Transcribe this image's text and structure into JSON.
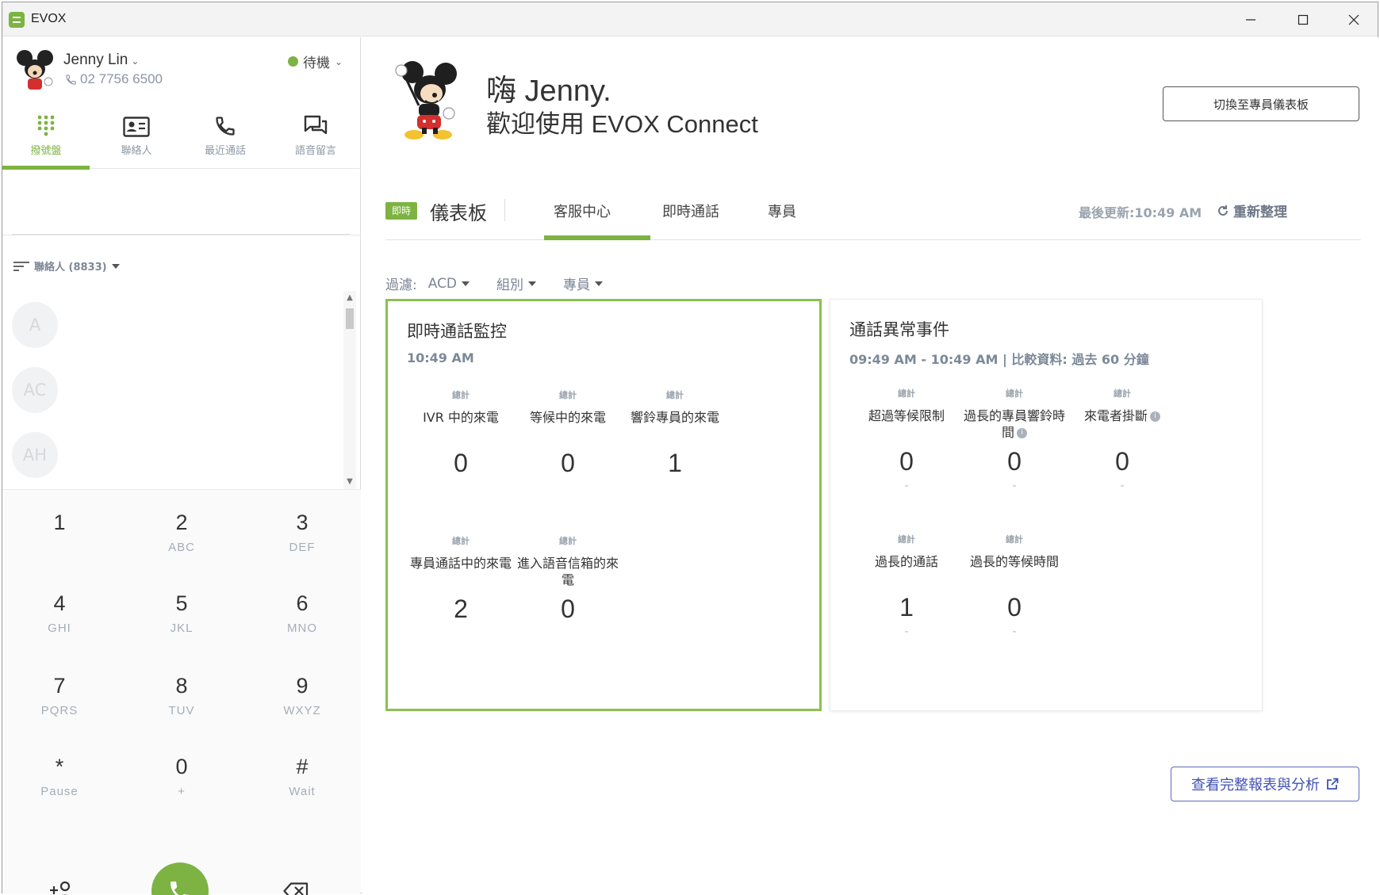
{
  "window": {
    "app_name": "EVOX",
    "minimize_icon": "minimize-icon",
    "maximize_icon": "maximize-icon",
    "close_icon": "close-icon"
  },
  "user": {
    "name": "Jenny Lin",
    "phone": "02 7756 6500",
    "status": "待機",
    "status_color": "#7cb342"
  },
  "nav": {
    "items": [
      {
        "label": "撥號盤",
        "icon": "dialpad-icon",
        "active": true
      },
      {
        "label": "聯絡人",
        "icon": "contact-card-icon",
        "active": false
      },
      {
        "label": "最近通話",
        "icon": "phone-icon",
        "active": false
      },
      {
        "label": "語音留言",
        "icon": "voicemail-chat-icon",
        "active": false
      }
    ]
  },
  "contacts": {
    "header": "聯絡人 (8833)",
    "items": [
      "A",
      "AC",
      "AH"
    ]
  },
  "dialpad": {
    "keys": [
      {
        "digit": "1",
        "sub": ""
      },
      {
        "digit": "2",
        "sub": "ABC"
      },
      {
        "digit": "3",
        "sub": "DEF"
      },
      {
        "digit": "4",
        "sub": "GHI"
      },
      {
        "digit": "5",
        "sub": "JKL"
      },
      {
        "digit": "6",
        "sub": "MNO"
      },
      {
        "digit": "7",
        "sub": "PQRS"
      },
      {
        "digit": "8",
        "sub": "TUV"
      },
      {
        "digit": "9",
        "sub": "WXYZ"
      },
      {
        "digit": "*",
        "sub": "Pause"
      },
      {
        "digit": "0",
        "sub": "+"
      },
      {
        "digit": "#",
        "sub": "Wait"
      }
    ],
    "add_contact_icon": "add-person-icon",
    "call_icon": "phone-call-icon",
    "backspace_icon": "backspace-icon"
  },
  "header": {
    "greeting": "嗨 Jenny.",
    "welcome": "歡迎使用 EVOX Connect",
    "switch_button": "切換至專員儀表板"
  },
  "dashboard": {
    "live_badge": "即時",
    "title": "儀表板",
    "tabs": [
      "客服中心",
      "即時通話",
      "專員"
    ],
    "active_tab": "客服中心",
    "last_updated": "最後更新:10:49 AM",
    "refresh": "重新整理",
    "accent": "#7cb342"
  },
  "filters": {
    "label": "過濾:",
    "items": [
      "ACD",
      "組別",
      "專員"
    ]
  },
  "live_monitor": {
    "title": "即時通話監控",
    "time": "10:49 AM",
    "metrics": [
      {
        "total": "總計",
        "name": "IVR 中的來電",
        "value": "0"
      },
      {
        "total": "總計",
        "name": "等候中的來電",
        "value": "0"
      },
      {
        "total": "總計",
        "name": "響鈴專員的來電",
        "value": "1"
      },
      {
        "total": "總計",
        "name": "專員通話中的來電",
        "value": "2"
      },
      {
        "total": "總計",
        "name": "進入語音信箱的來電",
        "value": "0"
      }
    ]
  },
  "anomalies": {
    "title": "通話異常事件",
    "subtitle": "09:49 AM - 10:49 AM | 比較資料: 過去 60 分鐘",
    "metrics": [
      {
        "total": "總計",
        "name": "超過等候限制",
        "value": "0",
        "trend": "-",
        "info": false
      },
      {
        "total": "總計",
        "name": "過長的專員響鈴時間",
        "value": "0",
        "trend": "-",
        "info": true
      },
      {
        "total": "總計",
        "name": "來電者掛斷",
        "value": "0",
        "trend": "-",
        "info": true
      },
      {
        "total": "總計",
        "name": "過長的通話",
        "value": "1",
        "trend": "-",
        "info": false
      },
      {
        "total": "總計",
        "name": "過長的等候時間",
        "value": "0",
        "trend": "-",
        "info": false
      }
    ]
  },
  "report_link": "查看完整報表與分析"
}
